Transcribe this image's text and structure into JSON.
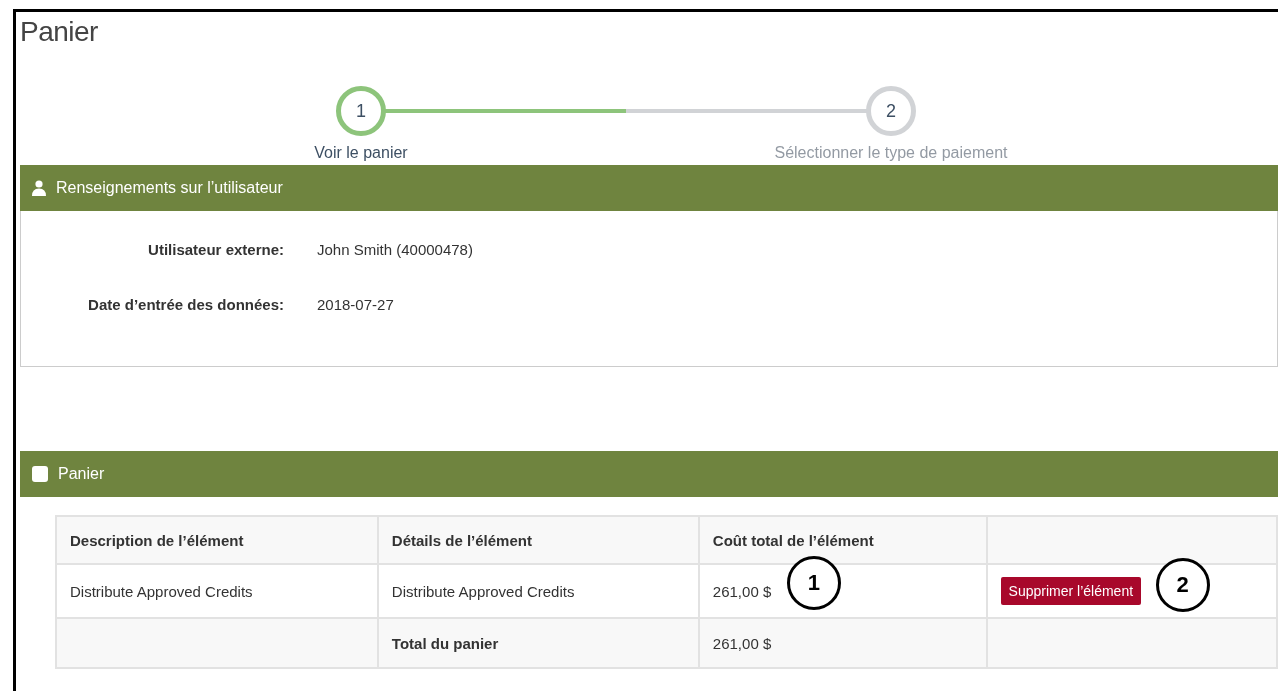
{
  "page": {
    "title": "Panier"
  },
  "stepper": {
    "level": 0.5,
    "steps": [
      {
        "number": "1",
        "label": "Voir le panier",
        "selected": true
      },
      {
        "number": "2",
        "label": "Sélectionner le type de paiement",
        "selected": false
      }
    ]
  },
  "user_panel": {
    "title": "Renseignements sur l’utilisateur",
    "fields": [
      {
        "label": "Utilisateur externe:",
        "value": "John Smith (40000478)"
      },
      {
        "label": "Date d’entrée des données:",
        "value": "2018-07-27"
      }
    ]
  },
  "cart_panel": {
    "title": "Panier",
    "table": {
      "columns": [
        "Description de l’élément",
        "Détails de l’élément",
        "Coût total de l’élément"
      ],
      "rows": [
        {
          "description": "Distribute Approved Credits",
          "details": "Distribute Approved Credits",
          "cost": "261,00 $",
          "cost_callout": "1",
          "action": "Supprimer l’élément",
          "action_callout": "2"
        }
      ],
      "total": {
        "label": "Total du panier",
        "value": "261,00 $"
      }
    }
  }
}
